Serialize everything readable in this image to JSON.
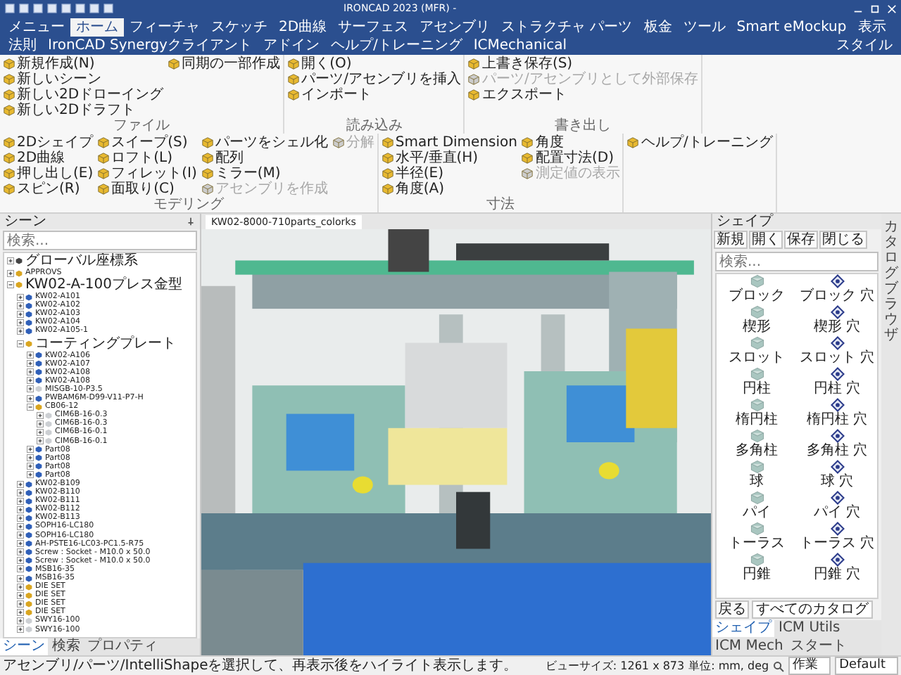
{
  "window": {
    "title": "IRONCAD 2023 (MFR) -",
    "style_menu": "スタイル"
  },
  "menu_tabs": [
    {
      "label": "メニュー",
      "selected": false
    },
    {
      "label": "ホーム",
      "selected": true
    },
    {
      "label": "フィーチャ",
      "selected": false
    },
    {
      "label": "スケッチ",
      "selected": false
    },
    {
      "label": "2D曲線",
      "selected": false
    },
    {
      "label": "サーフェス",
      "selected": false
    },
    {
      "label": "アセンブリ",
      "selected": false
    },
    {
      "label": "ストラクチャ パーツ",
      "selected": false
    },
    {
      "label": "板金",
      "selected": false
    },
    {
      "label": "ツール",
      "selected": false
    },
    {
      "label": "Smart eMockup",
      "selected": false
    },
    {
      "label": "表示",
      "selected": false
    },
    {
      "label": "法則",
      "selected": false
    },
    {
      "label": "IronCAD Synergyクライアント",
      "selected": false
    },
    {
      "label": "アドイン",
      "selected": false
    },
    {
      "label": "ヘルプ/トレーニング",
      "selected": false
    },
    {
      "label": "ICMechanical",
      "selected": false
    }
  ],
  "ribbon": {
    "groups": [
      {
        "label": "ファイル",
        "buttons": [
          {
            "label": "新規作成(N)",
            "disabled": false
          },
          {
            "label": "新しいシーン",
            "disabled": false
          },
          {
            "label": "新しい2Dドローイング",
            "disabled": false
          },
          {
            "label": "新しい2Dドラフト",
            "disabled": false
          },
          {
            "label": "同期の一部作成",
            "disabled": false
          }
        ]
      },
      {
        "label": "読み込み",
        "buttons": [
          {
            "label": "開く(O)",
            "disabled": false
          },
          {
            "label": "パーツ/アセンブリを挿入",
            "disabled": false
          },
          {
            "label": "インポート",
            "disabled": false
          }
        ]
      },
      {
        "label": "書き出し",
        "buttons": [
          {
            "label": "上書き保存(S)",
            "disabled": false
          },
          {
            "label": "パーツ/アセンブリとして外部保存",
            "disabled": true
          },
          {
            "label": "エクスポート",
            "disabled": false
          }
        ]
      },
      {
        "label": "モデリング",
        "buttons": [
          {
            "label": "2Dシェイプ",
            "disabled": false
          },
          {
            "label": "2D曲線",
            "disabled": false
          },
          {
            "label": "押し出し(E)",
            "disabled": false
          },
          {
            "label": "スピン(R)",
            "disabled": false
          },
          {
            "label": "スイープ(S)",
            "disabled": false
          },
          {
            "label": "ロフト(L)",
            "disabled": false
          },
          {
            "label": "フィレット(I)",
            "disabled": false
          },
          {
            "label": "面取り(C)",
            "disabled": false
          },
          {
            "label": "パーツをシェル化",
            "disabled": false
          },
          {
            "label": "配列",
            "disabled": false
          },
          {
            "label": "ミラー(M)",
            "disabled": false
          },
          {
            "label": "アセンブリを作成",
            "disabled": true
          },
          {
            "label": "分解",
            "disabled": true
          }
        ]
      },
      {
        "label": "寸法",
        "buttons": [
          {
            "label": "Smart Dimension",
            "disabled": false
          },
          {
            "label": "水平/垂直(H)",
            "disabled": false
          },
          {
            "label": "半径(E)",
            "disabled": false
          },
          {
            "label": "角度(A)",
            "disabled": false
          },
          {
            "label": "角度",
            "disabled": false
          },
          {
            "label": "配置寸法(D)",
            "disabled": false
          },
          {
            "label": "測定値の表示",
            "disabled": true
          }
        ]
      },
      {
        "buttons": [
          {
            "label": "ヘルプ/トレーニング",
            "disabled": false
          }
        ]
      }
    ]
  },
  "scene_panel": {
    "title": "シーン",
    "search": {
      "placeholder": "検索..."
    },
    "tree": [
      {
        "label": "グローバル座標系",
        "kind": "axes",
        "expanded": false
      },
      {
        "label": "APPROVS",
        "kind": "assembly",
        "expanded": false
      },
      {
        "label": "KW02-A-100プレス金型",
        "kind": "assembly",
        "expanded": true,
        "children": [
          {
            "label": "KW02-A101",
            "kind": "part",
            "expanded": false
          },
          {
            "label": "KW02-A102",
            "kind": "part",
            "expanded": false
          },
          {
            "label": "KW02-A103",
            "kind": "part",
            "expanded": false
          },
          {
            "label": "KW02-A104",
            "kind": "part",
            "expanded": false
          },
          {
            "label": "KW02-A105-1",
            "kind": "part",
            "expanded": false
          },
          {
            "label": "コーティングプレート",
            "kind": "assembly",
            "expanded": true,
            "children": [
              {
                "label": "KW02-A106",
                "kind": "part",
                "expanded": false
              },
              {
                "label": "KW02-A107",
                "kind": "part",
                "expanded": false
              },
              {
                "label": "KW02-A108",
                "kind": "part",
                "expanded": false
              },
              {
                "label": "KW02-A108",
                "kind": "part",
                "expanded": false
              },
              {
                "label": "MISGB-10-P3.5",
                "kind": "ghost",
                "expanded": false
              },
              {
                "label": "PWBAM6M-D99-V11-P7-H",
                "kind": "part",
                "expanded": false
              },
              {
                "label": "CB06-12",
                "kind": "assembly",
                "expanded": true,
                "children": [
                  {
                    "label": "CIM6B-16-0.3",
                    "kind": "ghost",
                    "expanded": false
                  },
                  {
                    "label": "CIM6B-16-0.3",
                    "kind": "ghost",
                    "expanded": false
                  },
                  {
                    "label": "CIM6B-16-0.1",
                    "kind": "ghost",
                    "expanded": false
                  },
                  {
                    "label": "CIM6B-16-0.1",
                    "kind": "ghost",
                    "expanded": false
                  }
                ]
              },
              {
                "label": "Part08",
                "kind": "part",
                "expanded": false
              },
              {
                "label": "Part08",
                "kind": "part",
                "expanded": false
              },
              {
                "label": "Part08",
                "kind": "part",
                "expanded": false
              },
              {
                "label": "Part08",
                "kind": "part",
                "expanded": false
              }
            ]
          },
          {
            "label": "KW02-B109",
            "kind": "part",
            "expanded": false
          },
          {
            "label": "KW02-B110",
            "kind": "part",
            "expanded": false
          },
          {
            "label": "KW02-B111",
            "kind": "part",
            "expanded": false
          },
          {
            "label": "KW02-B112",
            "kind": "part",
            "expanded": false
          },
          {
            "label": "KW02-B113",
            "kind": "part",
            "expanded": false
          },
          {
            "label": "SOPH16-LC180",
            "kind": "part",
            "expanded": false
          },
          {
            "label": "SOPH16-LC180",
            "kind": "part",
            "expanded": false
          },
          {
            "label": "AH-PSTE16-LC03-PC1.5-R75",
            "kind": "part",
            "expanded": false
          },
          {
            "label": "Screw : Socket - M10.0 x 50.0",
            "kind": "part",
            "expanded": false
          },
          {
            "label": "Screw : Socket - M10.0 x 50.0",
            "kind": "part",
            "expanded": false
          },
          {
            "label": "MSB16-35",
            "kind": "part",
            "expanded": false
          },
          {
            "label": "MSB16-35",
            "kind": "part",
            "expanded": false
          },
          {
            "label": "DIE SET",
            "kind": "assembly",
            "expanded": false
          },
          {
            "label": "DIE SET",
            "kind": "assembly",
            "expanded": false
          },
          {
            "label": "DIE SET",
            "kind": "assembly",
            "expanded": false
          },
          {
            "label": "DIE SET",
            "kind": "assembly",
            "expanded": false
          },
          {
            "label": "SWY16-100",
            "kind": "ghost",
            "expanded": false
          },
          {
            "label": "SWY16-100",
            "kind": "ghost",
            "expanded": false
          }
        ]
      }
    ],
    "tabs": [
      {
        "label": "シーン",
        "selected": true
      },
      {
        "label": "検索",
        "selected": false
      },
      {
        "label": "プロパティ",
        "selected": false
      }
    ]
  },
  "document_tab": {
    "title": "KW02-8000-710parts_colorks"
  },
  "catalog_panel": {
    "title": "シェイプ",
    "buttons": [
      "新規",
      "開く",
      "保存",
      "閉じる"
    ],
    "search": {
      "placeholder": "検索..."
    },
    "shapes": [
      {
        "label": "ブロック",
        "kind": "solid"
      },
      {
        "label": "ブロック 穴",
        "kind": "hole"
      },
      {
        "label": "楔形",
        "kind": "solid"
      },
      {
        "label": "楔形 穴",
        "kind": "hole"
      },
      {
        "label": "スロット",
        "kind": "solid"
      },
      {
        "label": "スロット 穴",
        "kind": "hole"
      },
      {
        "label": "円柱",
        "kind": "solid"
      },
      {
        "label": "円柱 穴",
        "kind": "hole"
      },
      {
        "label": "楕円柱",
        "kind": "solid"
      },
      {
        "label": "楕円柱 穴",
        "kind": "hole"
      },
      {
        "label": "多角柱",
        "kind": "solid"
      },
      {
        "label": "多角柱 穴",
        "kind": "hole"
      },
      {
        "label": "球",
        "kind": "solid"
      },
      {
        "label": "球 穴",
        "kind": "hole"
      },
      {
        "label": "パイ",
        "kind": "solid"
      },
      {
        "label": "パイ 穴",
        "kind": "hole"
      },
      {
        "label": "トーラス",
        "kind": "solid"
      },
      {
        "label": "トーラス 穴",
        "kind": "hole"
      },
      {
        "label": "円錐",
        "kind": "solid"
      },
      {
        "label": "円錐 穴",
        "kind": "hole"
      }
    ],
    "back_button": "戻る",
    "catalog_field": "すべてのカタログ",
    "tabs": [
      {
        "label": "シェイプ",
        "selected": true
      },
      {
        "label": "ICM Utils",
        "selected": false
      },
      {
        "label": "ICM Mech",
        "selected": false
      },
      {
        "label": "スタート",
        "selected": false
      }
    ]
  },
  "side_tab": "カタログブラウザ",
  "status_bar": {
    "message": "アセンブリ/パーツ/IntelliShapeを選択して、再表示後をハイライト表示します。",
    "view_size": "ビューサイズ: 1261 x 873",
    "units": "単位: mm, deg",
    "mode": "作業",
    "style": "Default"
  }
}
